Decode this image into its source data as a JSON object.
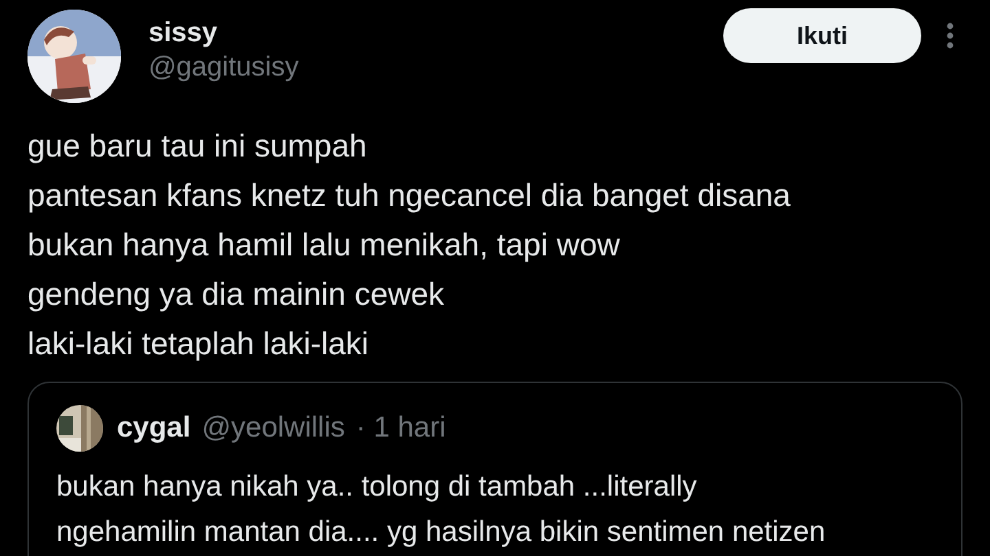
{
  "author": {
    "name": "sissy",
    "handle": "@gagitusisy"
  },
  "follow_button": {
    "label": "Ikuti"
  },
  "text": "gue baru tau ini sumpah\npantesan kfans knetz tuh ngecancel dia banget disana\nbukan hanya hamil lalu menikah, tapi wow\ngendeng ya dia mainin cewek\nlaki-laki tetaplah laki-laki",
  "quoted_tweet": {
    "name": "cygal",
    "handle": "@yeolwillis",
    "time": "· 1 hari",
    "text": "bukan hanya nikah ya.. tolong di tambah ...literally\nngehamilin mantan dia.... yg hasilnya bikin sentimen netizen"
  }
}
